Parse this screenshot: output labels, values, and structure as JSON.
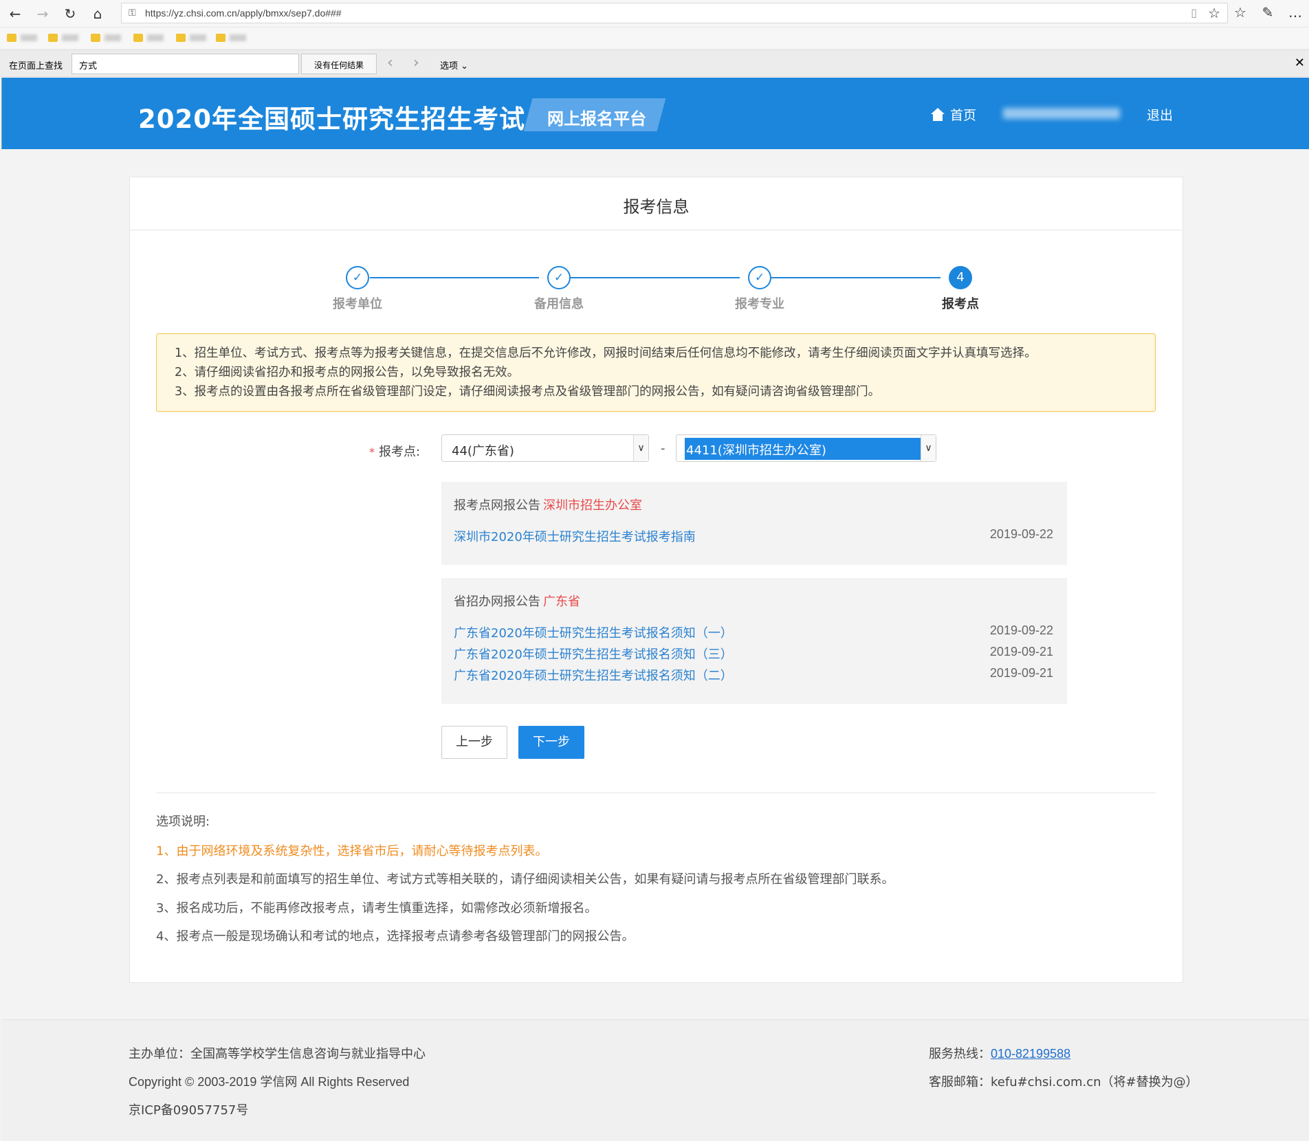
{
  "browser": {
    "back_icon": "←",
    "forward_icon": "→",
    "refresh_icon": "↻",
    "home_icon": "⌂",
    "lock_icon": "🔒",
    "url": "https://yz.chsi.com.cn/apply/bmxx/sep7.do###",
    "reader_icon": "▯",
    "star_icon": "☆",
    "favorites_icon": "☆",
    "pen_icon": "✎",
    "more_icon": "…"
  },
  "findbar": {
    "label": "在页面上查找",
    "query": "方式",
    "result": "没有任何结果",
    "prev_icon": "‹",
    "next_icon": "›",
    "options": "选项",
    "options_caret": "⌄",
    "close_icon": "✕"
  },
  "header": {
    "title": "2020年全国硕士研究生招生考试",
    "platform": "网上报名平台",
    "home": "首页",
    "logout": "退出"
  },
  "panel": {
    "title": "报考信息"
  },
  "steps": [
    {
      "mark": "✓",
      "label": "报考单位"
    },
    {
      "mark": "✓",
      "label": "备用信息"
    },
    {
      "mark": "✓",
      "label": "报考专业"
    },
    {
      "mark": "4",
      "label": "报考点"
    }
  ],
  "notice": [
    "1、招生单位、考试方式、报考点等为报考关键信息，在提交信息后不允许修改，网报时间结束后任何信息均不能修改，请考生仔细阅读页面文字并认真填写选择。",
    "2、请仔细阅读省招办和报考点的网报公告，以免导致报名无效。",
    "3、报考点的设置由各报考点所在省级管理部门设定，请仔细阅读报考点及省级管理部门的网报公告，如有疑问请咨询省级管理部门。"
  ],
  "form": {
    "required_mark": "*",
    "label": "报考点:",
    "province_value": "44(广东省)",
    "dash": "-",
    "site_value": "4411(深圳市招生办公室)",
    "caret": "∨"
  },
  "site_announcements": {
    "heading": "报考点网报公告",
    "place": "深圳市招生办公室",
    "items": [
      {
        "title": "深圳市2020年硕士研究生招生考试报考指南",
        "date": "2019-09-22"
      }
    ]
  },
  "province_announcements": {
    "heading": "省招办网报公告",
    "place": "广东省",
    "items": [
      {
        "title": "广东省2020年硕士研究生招生考试报名须知（一）",
        "date": "2019-09-22"
      },
      {
        "title": "广东省2020年硕士研究生招生考试报名须知（三）",
        "date": "2019-09-21"
      },
      {
        "title": "广东省2020年硕士研究生招生考试报名须知（二）",
        "date": "2019-09-21"
      }
    ]
  },
  "buttons": {
    "prev": "上一步",
    "next": "下一步"
  },
  "help": {
    "title": "选项说明:",
    "items": [
      "1、由于网络环境及系统复杂性，选择省市后，请耐心等待报考点列表。",
      "2、报考点列表是和前面填写的招生单位、考试方式等相关联的，请仔细阅读相关公告，如果有疑问请与报考点所在省级管理部门联系。",
      "3、报名成功后，不能再修改报考点，请考生慎重选择，如需修改必须新增报名。",
      "4、报考点一般是现场确认和考试的地点，选择报考点请参考各级管理部门的网报公告。"
    ]
  },
  "footer": {
    "sponsor": "主办单位：全国高等学校学生信息咨询与就业指导中心",
    "copyright": "Copyright © 2003-2019 学信网 All Rights Reserved",
    "icp": "京ICP备09057757号",
    "hotline_label": "服务热线：",
    "hotline": "010-82199588",
    "email": "客服邮箱：kefu#chsi.com.cn（将#替换为@）"
  },
  "colors": {
    "brand_blue": "#1c86dc",
    "link_blue": "#2b82d0",
    "warning_orange": "#f08c21",
    "required_red": "#e94a4a",
    "notice_bg": "#fef8e2"
  }
}
